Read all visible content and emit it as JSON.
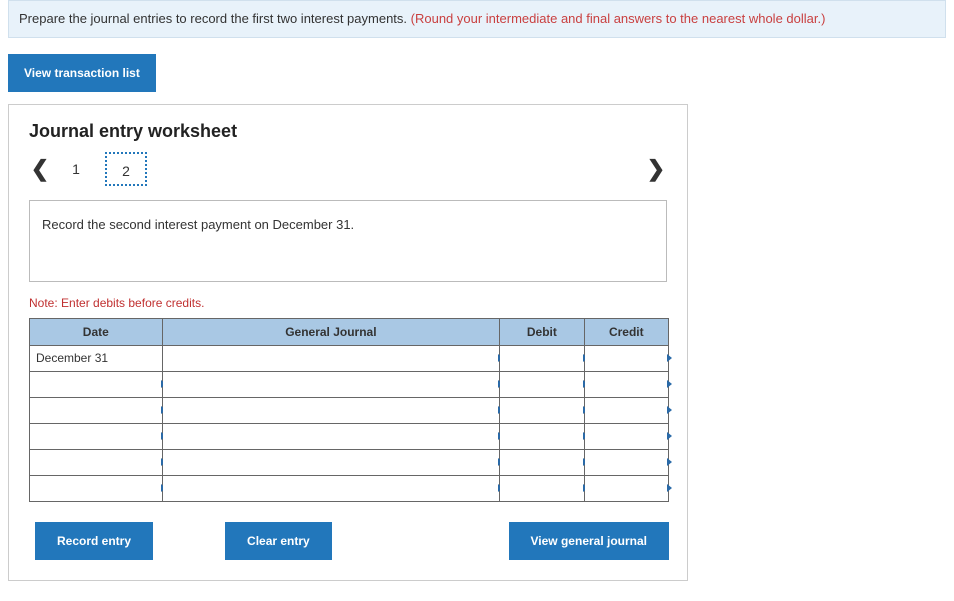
{
  "instruction": {
    "black": "Prepare the journal entries to record the first two interest payments. ",
    "red": "(Round your intermediate and final answers to the nearest whole dollar.)"
  },
  "view_tx_label": "View transaction list",
  "worksheet": {
    "title": "Journal entry worksheet",
    "pager": {
      "p1": "1",
      "p2": "2"
    },
    "prompt": "Record the second interest payment on December 31.",
    "note": "Note: Enter debits before credits.",
    "headers": {
      "date": "Date",
      "gj": "General Journal",
      "debit": "Debit",
      "credit": "Credit"
    },
    "rows": [
      {
        "date": "December 31",
        "gj": "",
        "debit": "",
        "credit": ""
      },
      {
        "date": "",
        "gj": "",
        "debit": "",
        "credit": ""
      },
      {
        "date": "",
        "gj": "",
        "debit": "",
        "credit": ""
      },
      {
        "date": "",
        "gj": "",
        "debit": "",
        "credit": ""
      },
      {
        "date": "",
        "gj": "",
        "debit": "",
        "credit": ""
      },
      {
        "date": "",
        "gj": "",
        "debit": "",
        "credit": ""
      }
    ],
    "buttons": {
      "record": "Record entry",
      "clear": "Clear entry",
      "view_gj": "View general journal"
    }
  }
}
